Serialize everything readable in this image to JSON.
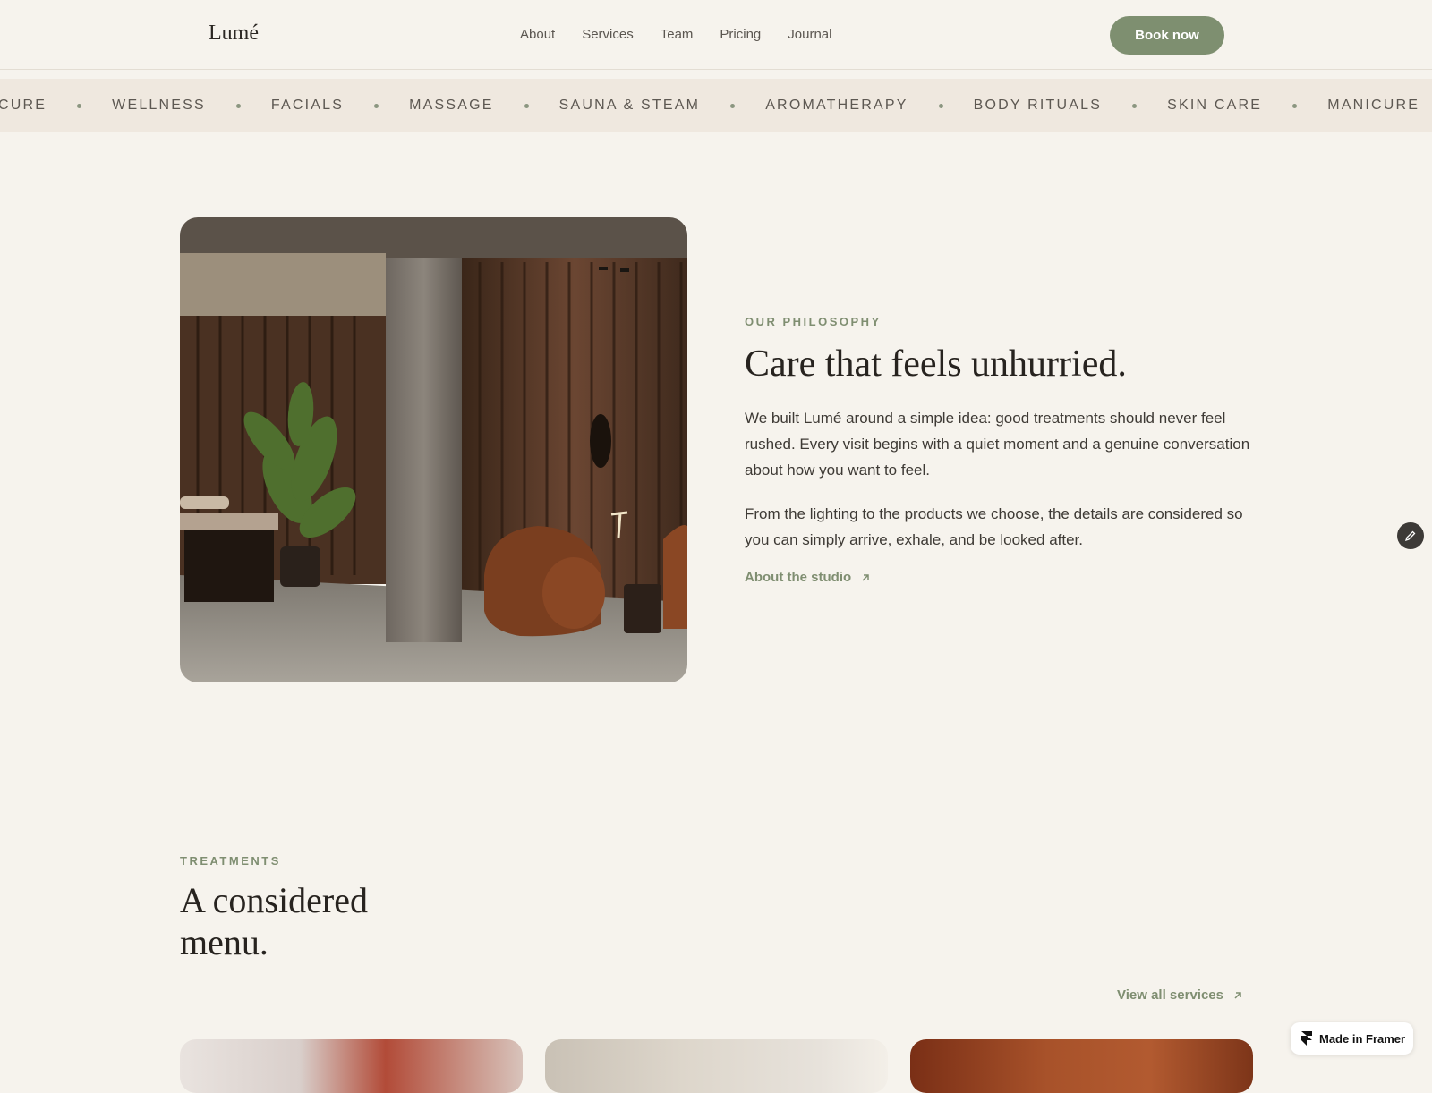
{
  "brand": {
    "name": "Lumé"
  },
  "nav": {
    "links": [
      "About",
      "Services",
      "Team",
      "Pricing",
      "Journal"
    ],
    "cta": "Book now"
  },
  "marquee": {
    "items": [
      "CURE",
      "WELLNESS",
      "FACIALS",
      "MASSAGE",
      "SAUNA & STEAM",
      "AROMATHERAPY",
      "BODY RITUALS",
      "SKIN CARE",
      "MANICURE"
    ]
  },
  "philosophy": {
    "eyebrow": "OUR PHILOSOPHY",
    "title": "Care that feels unhurried.",
    "paragraph_1": "We built Lumé around a simple idea: good treatments should never feel rushed. Every visit begins with a quiet moment and a genuine conversation about how you want to feel.",
    "paragraph_2": "From the lighting to the products we choose, the details are considered so you can simply arrive, exhale, and be looked after.",
    "link": "About the studio"
  },
  "treatments": {
    "eyebrow": "TREATMENTS",
    "title": "A considered menu.",
    "link": "View all services"
  },
  "badge": {
    "label": "Made in Framer"
  },
  "colors": {
    "background": "#f6f3ed",
    "accent": "#7e8f70",
    "marquee_bg": "#efe8df",
    "text_dark": "#27231f"
  }
}
